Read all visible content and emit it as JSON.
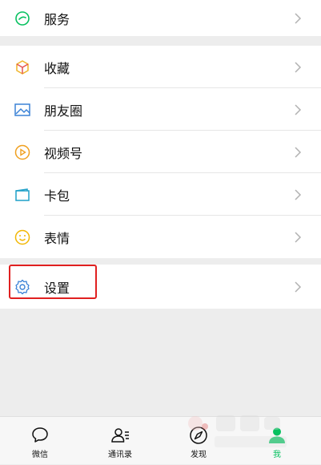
{
  "menu": {
    "services": "服务",
    "favorites": "收藏",
    "moments": "朋友圈",
    "channels": "视频号",
    "cards": "卡包",
    "stickers": "表情",
    "settings": "设置"
  },
  "tabs": [
    {
      "label": "微信",
      "icon": "chat-icon"
    },
    {
      "label": "通讯录",
      "icon": "contacts-icon"
    },
    {
      "label": "发现",
      "icon": "compass-icon"
    },
    {
      "label": "我",
      "icon": "person-icon",
      "active": true
    }
  ],
  "colors": {
    "accent": "#07c160",
    "highlight": "#e02020",
    "background": "#ededed"
  }
}
